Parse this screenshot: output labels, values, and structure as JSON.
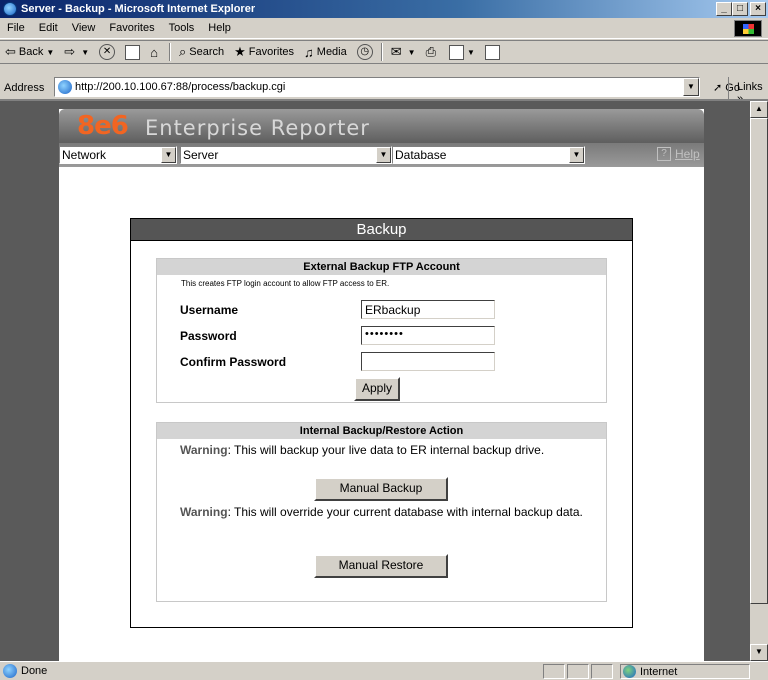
{
  "window": {
    "title": "Server - Backup - Microsoft Internet Explorer"
  },
  "menu": [
    "File",
    "Edit",
    "View",
    "Favorites",
    "Tools",
    "Help"
  ],
  "toolbar": {
    "back": "Back",
    "search": "Search",
    "favorites": "Favorites",
    "media": "Media"
  },
  "address": {
    "label": "Address",
    "url": "http://200.10.100.67:88/process/backup.cgi",
    "go": "Go",
    "links": "Links »"
  },
  "app": {
    "logo_num": "8e6",
    "logo_name": "Enterprise Reporter",
    "nav": {
      "network": "Network",
      "server": "Server",
      "database": "Database",
      "help": "Help"
    }
  },
  "backup": {
    "title": "Backup",
    "ftp": {
      "heading": "External Backup FTP Account",
      "note": "This creates FTP login account to allow FTP access to ER.",
      "username_label": "Username",
      "username_value": "ERbackup",
      "password_label": "Password",
      "password_value": "••••••••",
      "confirm_label": "Confirm Password",
      "confirm_value": "",
      "apply": "Apply"
    },
    "internal": {
      "heading": "Internal Backup/Restore Action",
      "warn_label": "Warning",
      "warn_backup": ": This will backup your live data to ER internal backup drive.",
      "backup_button": "Manual Backup",
      "warn_restore": ": This will override your current database with internal backup data.",
      "restore_button": "Manual Restore"
    }
  },
  "status": {
    "text": "Done",
    "zone": "Internet"
  }
}
